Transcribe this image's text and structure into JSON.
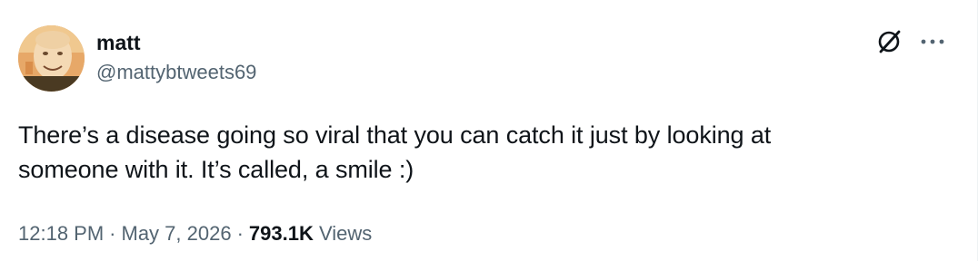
{
  "tweet": {
    "author": {
      "display_name": "matt",
      "handle": "@mattybtweets69"
    },
    "text_line_1": "There’s a disease going so viral that you can catch it just by looking at",
    "text_line_2": "someone with it. It’s called, a smile :)",
    "meta": {
      "time": "12:18 PM",
      "separator": "·",
      "date": "May 7, 2026",
      "views_count": "793.1K",
      "views_label": "Views"
    },
    "icons": {
      "grok": "grok-icon",
      "more": "more-icon"
    },
    "colors": {
      "text_primary": "#0f1419",
      "text_secondary": "#536471",
      "background": "#ffffff"
    }
  }
}
